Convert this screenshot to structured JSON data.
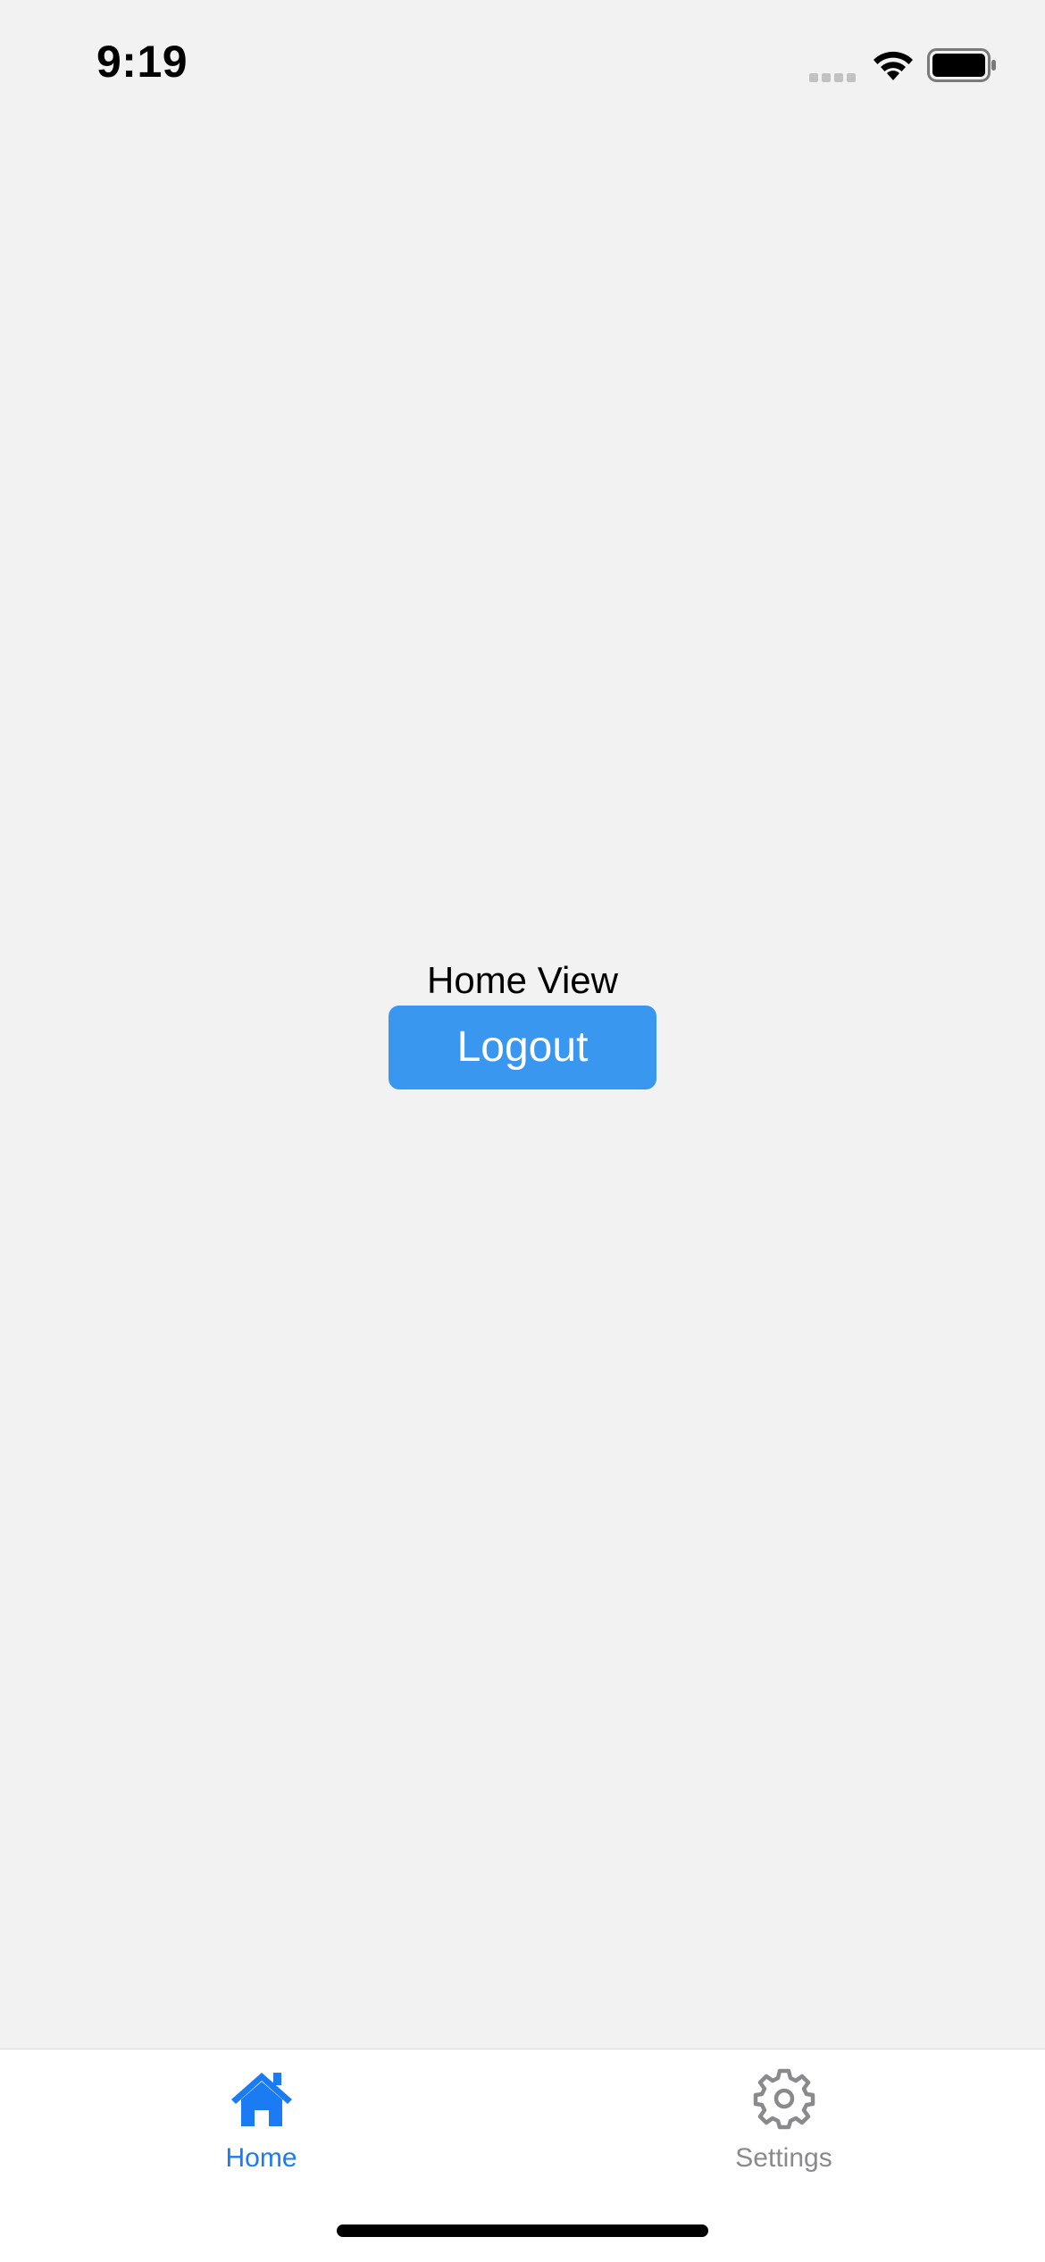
{
  "status_bar": {
    "time": "9:19",
    "icons": [
      "signal-icon",
      "wifi-icon",
      "battery-icon"
    ]
  },
  "main": {
    "title": "Home View",
    "logout_label": "Logout"
  },
  "tab_bar": {
    "tabs": [
      {
        "label": "Home",
        "icon": "house-icon",
        "selected": true
      },
      {
        "label": "Settings",
        "icon": "gear-icon",
        "selected": false
      }
    ]
  },
  "colors": {
    "background": "#f2f2f2",
    "accent": "#1a7bf2",
    "button": "#3a97ef",
    "inactive": "#8a8a8e"
  }
}
